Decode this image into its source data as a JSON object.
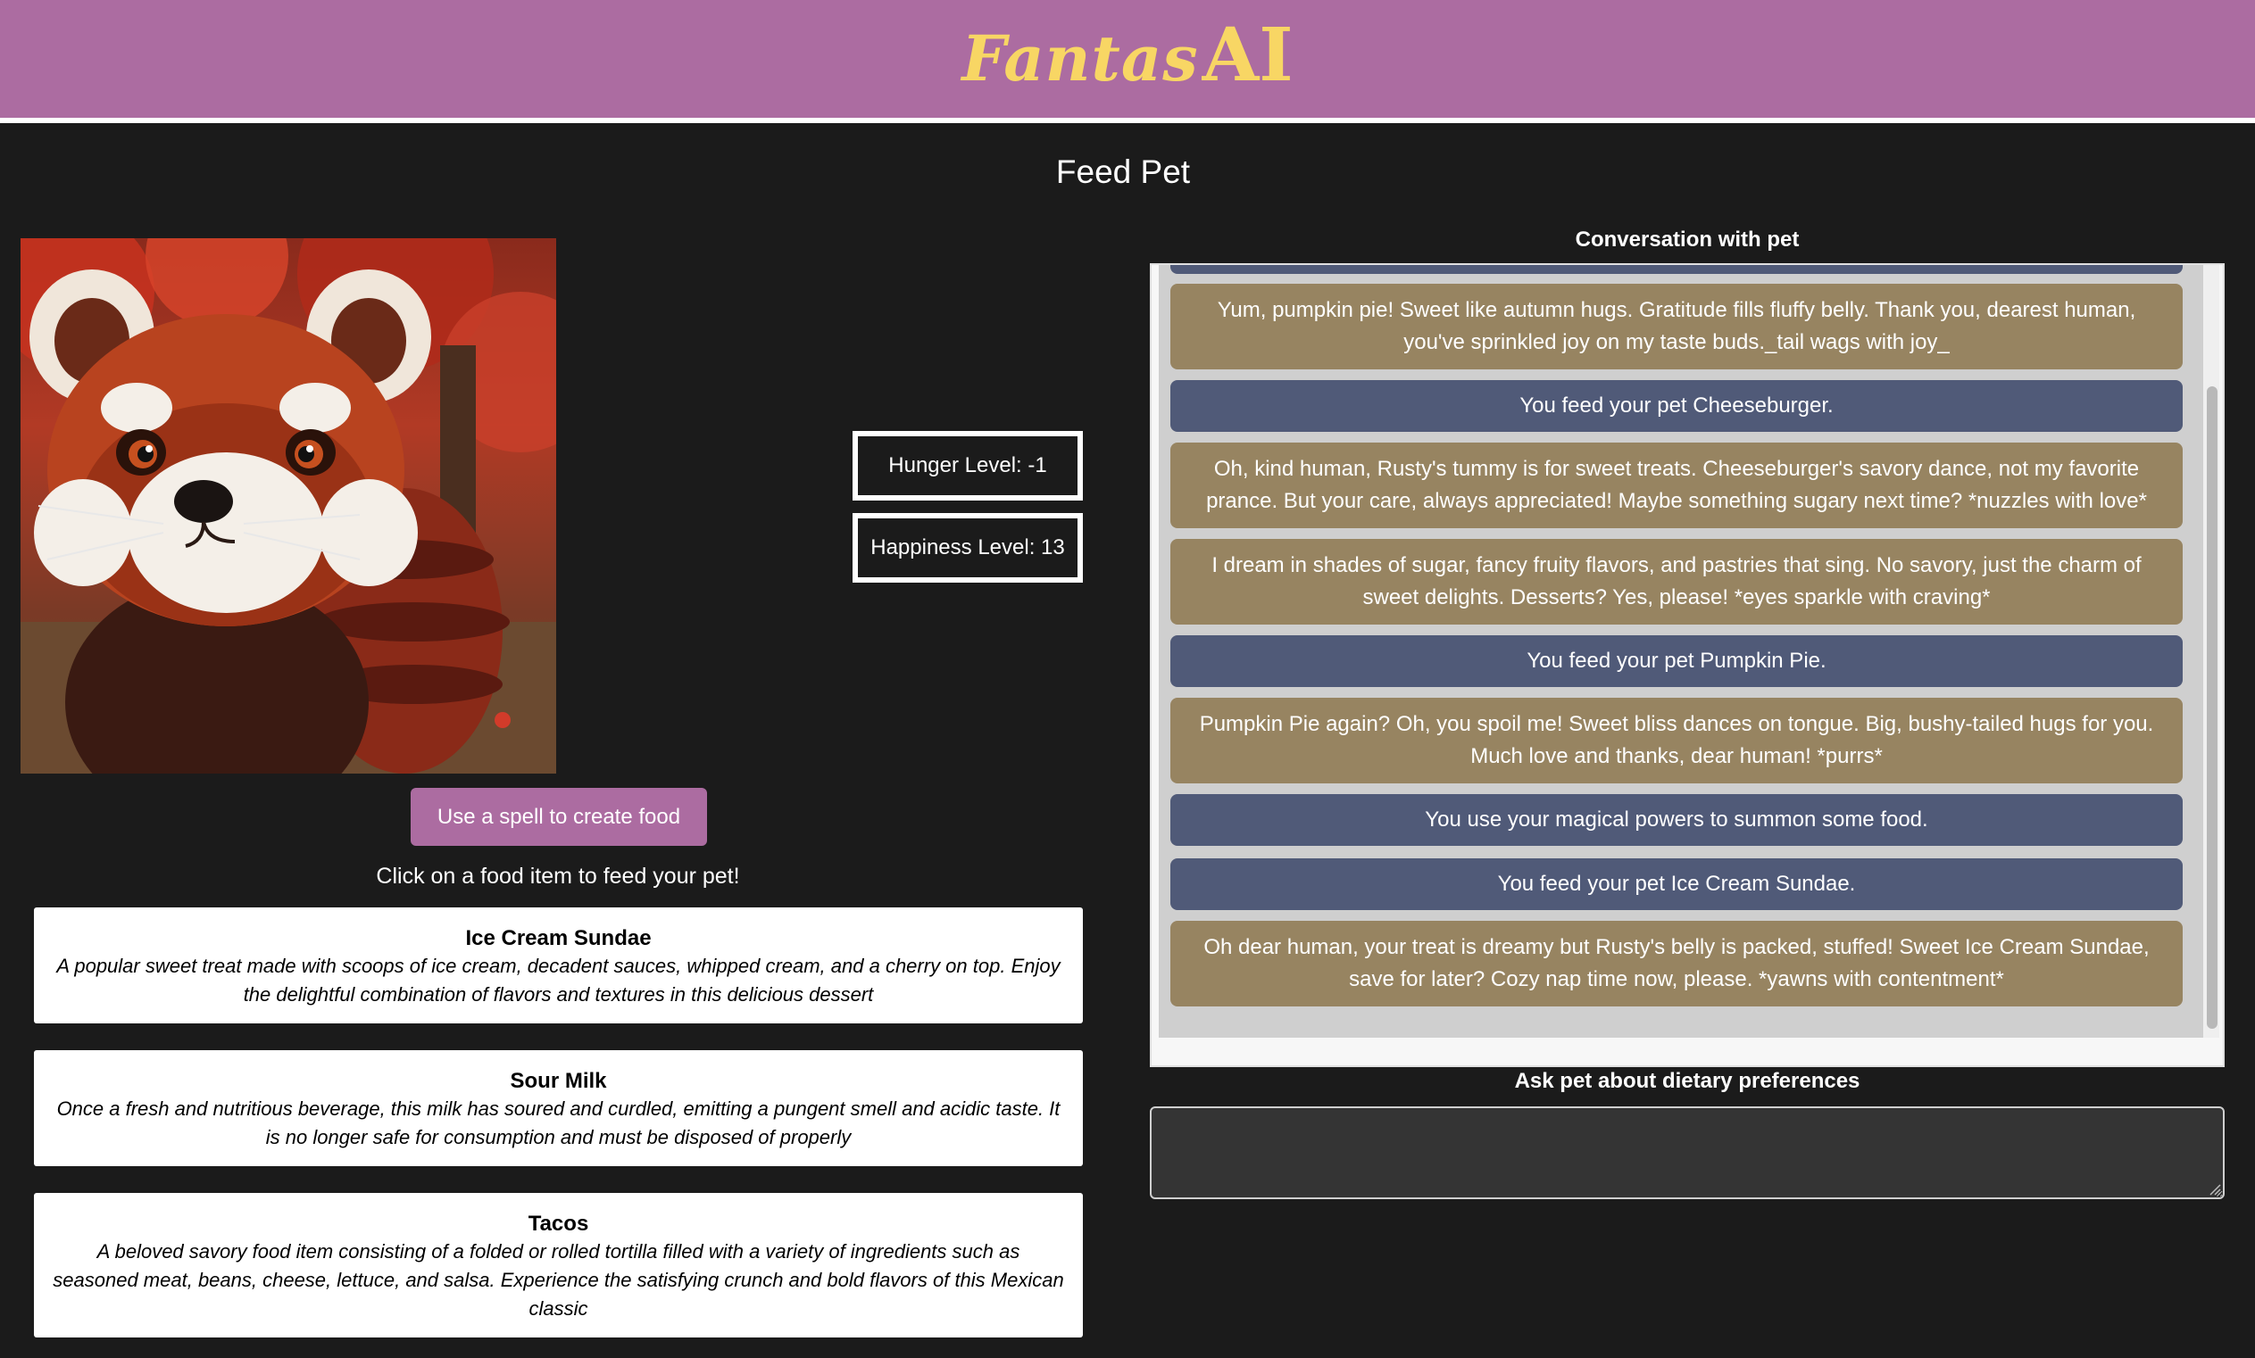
{
  "header": {
    "logo_script": "Fantas",
    "logo_ai": "AI",
    "logo_color": "#f8d664",
    "bar_color": "#ac6ca1"
  },
  "page_title": "Feed Pet",
  "pet": {
    "image_icon": "red-panda-image",
    "stats": {
      "hunger": "Hunger Level: -1",
      "happiness": "Happiness Level: 13"
    }
  },
  "spell_button_label": "Use a spell to create food",
  "instruction": "Click on a food item to feed your pet!",
  "foods": [
    {
      "name": "Ice Cream Sundae",
      "description": "A popular sweet treat made with scoops of ice cream, decadent sauces, whipped cream, and a cherry on top. Enjoy the delightful combination of flavors and textures in this delicious dessert"
    },
    {
      "name": "Sour Milk",
      "description": "Once a fresh and nutritious beverage, this milk has soured and curdled, emitting a pungent smell and acidic taste. It is no longer safe for consumption and must be disposed of properly"
    },
    {
      "name": "Tacos",
      "description": "A beloved savory food item consisting of a folded or rolled tortilla filled with a variety of ingredients such as seasoned meat, beans, cheese, lettuce, and salsa. Experience the satisfying crunch and bold flavors of this Mexican classic"
    }
  ],
  "conversation": {
    "label": "Conversation with pet",
    "colors": {
      "pet": "#978461",
      "user": "#505a78"
    },
    "messages": [
      {
        "from": "user",
        "text": ""
      },
      {
        "from": "pet",
        "text": "Yum, pumpkin pie! Sweet like autumn hugs. Gratitude fills fluffy belly. Thank you, dearest human, you've sprinkled joy on my taste buds._tail wags with joy_"
      },
      {
        "from": "user",
        "text": "You feed your pet Cheeseburger."
      },
      {
        "from": "pet",
        "text": "Oh, kind human, Rusty's tummy is for sweet treats. Cheeseburger's savory dance, not my favorite prance. But your care, always appreciated! Maybe something sugary next time? *nuzzles with love*"
      },
      {
        "from": "pet",
        "text": "I dream in shades of sugar, fancy fruity flavors, and pastries that sing. No savory, just the charm of sweet delights. Desserts? Yes, please! *eyes sparkle with craving*"
      },
      {
        "from": "user",
        "text": "You feed your pet Pumpkin Pie."
      },
      {
        "from": "pet",
        "text": "Pumpkin Pie again? Oh, you spoil me! Sweet bliss dances on tongue. Big, bushy-tailed hugs for you. Much love and thanks, dear human! *purrs*"
      },
      {
        "from": "user",
        "text": "You use your magical powers to summon some food."
      },
      {
        "from": "user",
        "text": "You feed your pet Ice Cream Sundae."
      },
      {
        "from": "pet",
        "text": "Oh dear human, your treat is dreamy but Rusty's belly is packed, stuffed! Sweet Ice Cream Sundae, save for later? Cozy nap time now, please. *yawns with contentment*"
      }
    ]
  },
  "ask": {
    "label": "Ask pet about dietary preferences",
    "value": "",
    "placeholder": ""
  }
}
